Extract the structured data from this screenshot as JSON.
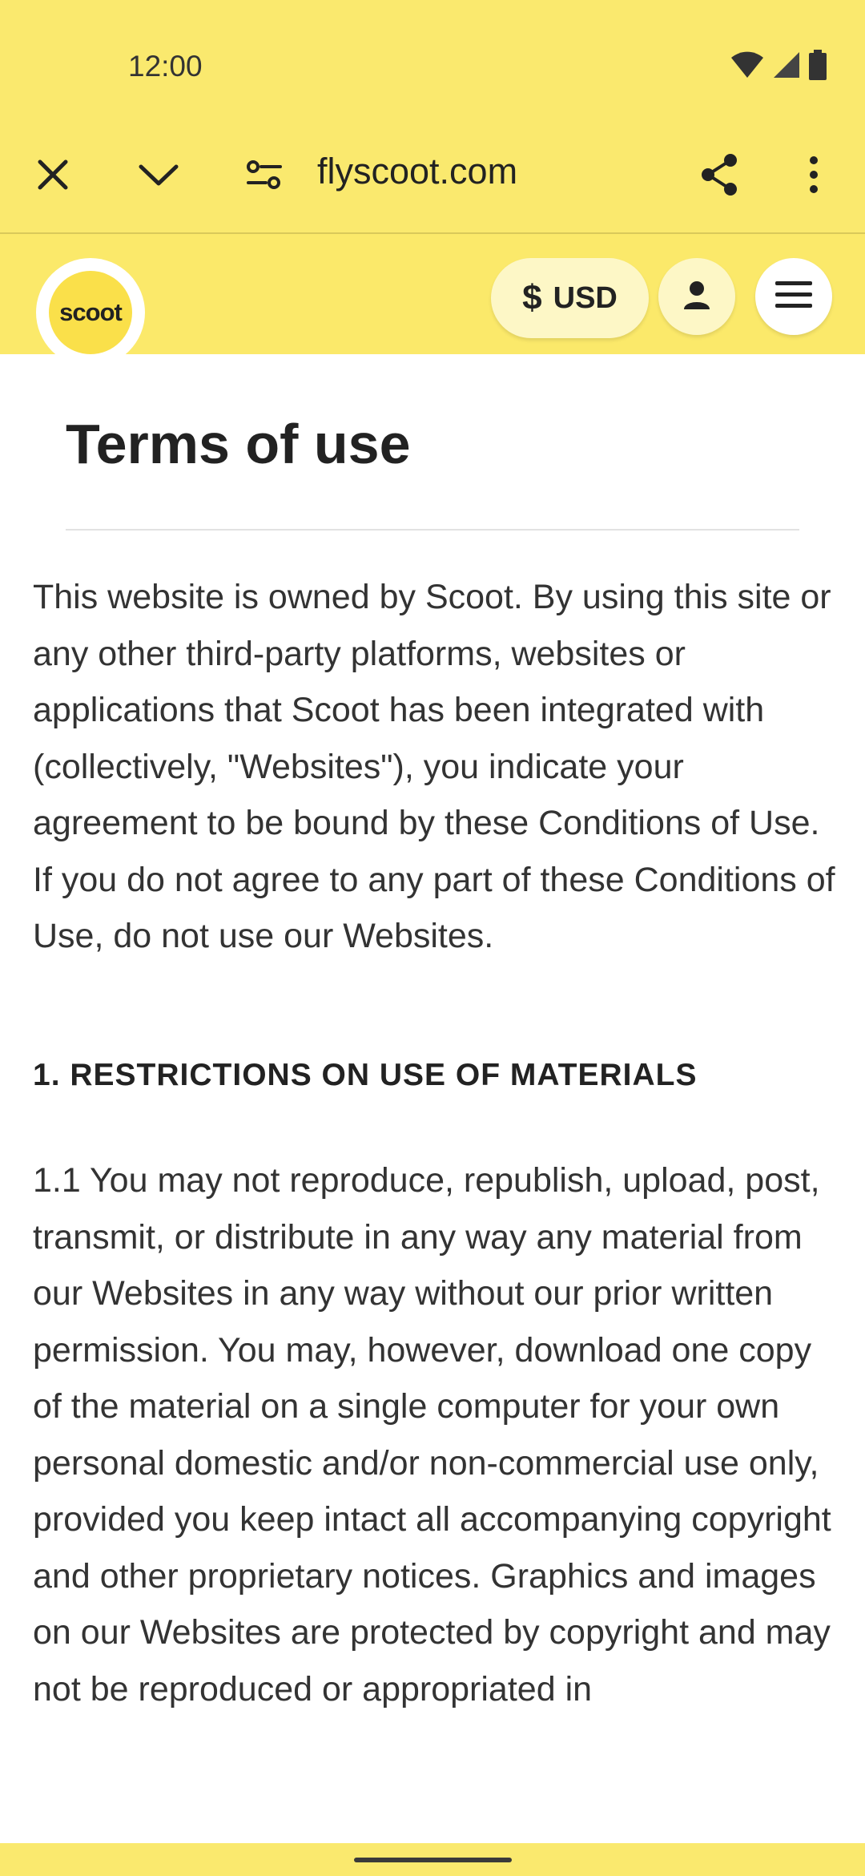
{
  "status_bar": {
    "time": "12:00",
    "icons": [
      "wifi-icon",
      "cell-signal-icon",
      "battery-icon"
    ]
  },
  "browser": {
    "url": "flyscoot.com",
    "icons": [
      "close-icon",
      "chevron-down-icon",
      "site-settings-icon",
      "share-icon",
      "more-vert-icon"
    ]
  },
  "header": {
    "logo_text": "scoot",
    "currency_symbol": "$",
    "currency_code": "USD",
    "icons": [
      "account-icon",
      "hamburger-menu-icon"
    ]
  },
  "page": {
    "title": "Terms of use",
    "intro": "This website is owned by Scoot. By using this site or any other third-party platforms, websites or applications that Scoot has been integrated with (collectively, \"Websites\"), you indicate your agreement to be bound by these Conditions of Use. If you do not agree to any part of these Conditions of Use, do not use our Websites.",
    "section1_heading": "1. RESTRICTIONS ON USE OF MATERIALS",
    "section1_para": "1.1 You may not reproduce, republish, upload, post, transmit, or distribute in any way any material from our Websites in any way without our prior written permission. You may, however, download one copy of the material on a single computer for your own personal domestic and/or non-commercial use only, provided you keep intact all accompanying copyright and other proprietary notices. Graphics and images on our Websites are protected by copyright and may not be reproduced or appropriated in"
  },
  "colors": {
    "brand_yellow": "#fae96e",
    "header_yellow": "#fbe96a",
    "pill_bg": "#fdf7c6",
    "text_dark": "#222222"
  }
}
